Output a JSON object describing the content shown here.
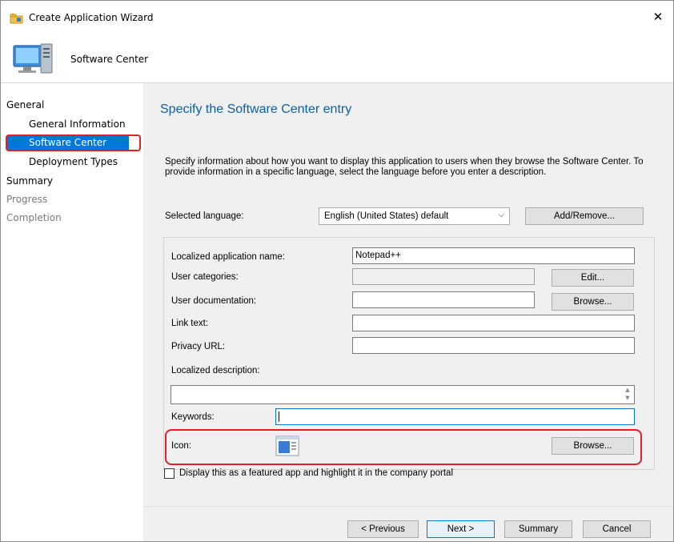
{
  "window": {
    "title": "Create Application Wizard",
    "close_glyph": "✕"
  },
  "header": {
    "title": "Software Center"
  },
  "nav": {
    "items": [
      {
        "label": "General",
        "state": "normal"
      },
      {
        "label": "General Information",
        "state": "normal"
      },
      {
        "label": "Software Center",
        "state": "selected"
      },
      {
        "label": "Deployment Types",
        "state": "normal"
      },
      {
        "label": "Summary",
        "state": "normal"
      },
      {
        "label": "Progress",
        "state": "disabled"
      },
      {
        "label": "Completion",
        "state": "disabled"
      }
    ]
  },
  "page": {
    "title": "Specify the Software Center entry",
    "description": "Specify information about how you want to display this application to users when they browse the Software Center. To provide information in a specific language, select the language before you enter a description."
  },
  "language": {
    "label": "Selected language:",
    "value": "English (United States) default",
    "arrow": "⌵",
    "add_remove_label": "Add/Remove..."
  },
  "form": {
    "app_name_label": "Localized application name:",
    "app_name_value": "Notepad++",
    "categories_label": "User categories:",
    "categories_value": "",
    "edit_label": "Edit...",
    "documentation_label": "User documentation:",
    "documentation_value": "",
    "browse_label": "Browse...",
    "link_text_label": "Link text:",
    "link_text_value": "",
    "privacy_label": "Privacy URL:",
    "privacy_value": "",
    "description_label": "Localized description:",
    "description_value": "",
    "keywords_label": "Keywords:",
    "keywords_value": "",
    "icon_label": "Icon:",
    "icon_browse_label": "Browse..."
  },
  "featured": {
    "label": "Display this as a featured app and highlight it in the company portal",
    "checked": false
  },
  "footer": {
    "previous_label": "< Previous",
    "next_label": "Next >",
    "summary_label": "Summary",
    "cancel_label": "Cancel"
  },
  "colors": {
    "accent": "#0078d7",
    "title_blue": "#0b5fa8",
    "highlight_red": "#e0202c",
    "panel_bg": "#f0f0f0"
  }
}
